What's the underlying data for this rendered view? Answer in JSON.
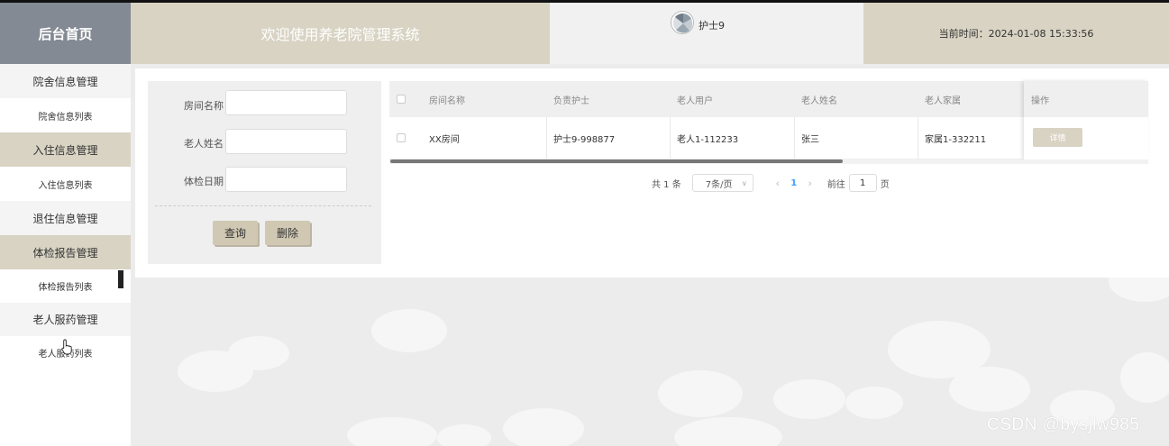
{
  "header": {
    "brand": "后台首页",
    "system_title": "欢迎使用养老院管理系统",
    "user_name": "护士9",
    "current_time": "当前时间：2024-01-08 15:33:56"
  },
  "sidebar": {
    "items": [
      {
        "label": "院舍信息管理",
        "type": "group"
      },
      {
        "label": "院舍信息列表",
        "type": "sub"
      },
      {
        "label": "入住信息管理",
        "type": "group"
      },
      {
        "label": "入住信息列表",
        "type": "sub"
      },
      {
        "label": "退住信息管理",
        "type": "group"
      },
      {
        "label": "体检报告管理",
        "type": "group"
      },
      {
        "label": "体检报告列表",
        "type": "sub"
      },
      {
        "label": "老人服药管理",
        "type": "group"
      },
      {
        "label": "老人服药列表",
        "type": "sub"
      }
    ]
  },
  "search": {
    "room_label": "房间名称",
    "room_value": "",
    "elder_label": "老人姓名",
    "elder_value": "",
    "date_label": "体检日期",
    "date_value": "",
    "query_button": "查询",
    "delete_button": "删除"
  },
  "table": {
    "columns": [
      "房间名称",
      "负责护士",
      "老人用户",
      "老人姓名",
      "老人家属"
    ],
    "operation_header": "操作",
    "rows": [
      {
        "cells": [
          "XX房间",
          "护士9-998877",
          "老人1-112233",
          "张三",
          "家属1-332211"
        ],
        "action": "详情"
      }
    ]
  },
  "pagination": {
    "total": "共 1 条",
    "page_size": "7条/页",
    "current_page": "1",
    "goto_prefix": "前往",
    "goto_value": "1",
    "goto_suffix": "页"
  },
  "watermark": "CSDN @bysjlw985",
  "colors": {
    "accent": "#d8d3c3",
    "brand_bg": "#848a93",
    "active_page": "#409eff"
  }
}
